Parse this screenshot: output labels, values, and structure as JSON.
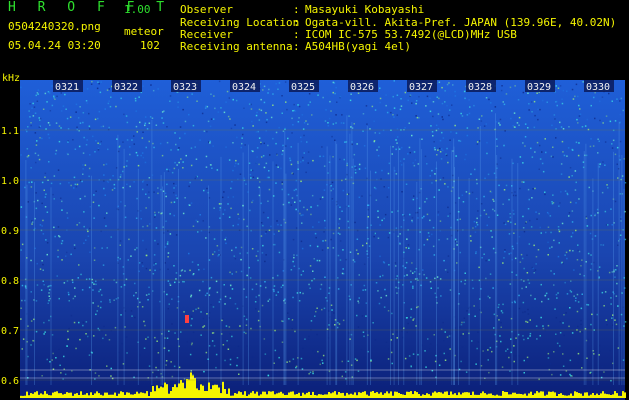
{
  "app": {
    "title": "H R O F F T",
    "version": "1.00",
    "file_name": "0504240320.png",
    "mode": "meteor",
    "timestamp": "05.04.24 03:20",
    "count": "102"
  },
  "info": [
    {
      "key": "Observer",
      "value": "Masayuki Kobayashi"
    },
    {
      "key": "Receiving Location",
      "value": "Ogata-vill. Akita-Pref. JAPAN (139.96E, 40.02N)"
    },
    {
      "key": "Receiver",
      "value": "ICOM IC-575 53.7492(@LCD)MHz USB"
    },
    {
      "key": "Receiving antenna",
      "value": "A504HB(yagi 4el)"
    }
  ],
  "axis": {
    "unit": "kHz",
    "y_ticks": [
      "1.1",
      "1.0",
      "0.9",
      "0.8",
      "0.7",
      "0.6"
    ],
    "x_ticks": [
      "0321",
      "0322",
      "0323",
      "0324",
      "0325",
      "0326",
      "0327",
      "0328",
      "0329",
      "0330"
    ]
  },
  "colors": {
    "background": "#000000",
    "header_title": "#2ee02e",
    "header_info": "#f5f500",
    "spectrum_low": "#0a1a6e",
    "spectrum_mid": "#1e5ae6",
    "spectrum_high": "#3ce6e6",
    "meteor_trace": "#f5f500"
  }
}
